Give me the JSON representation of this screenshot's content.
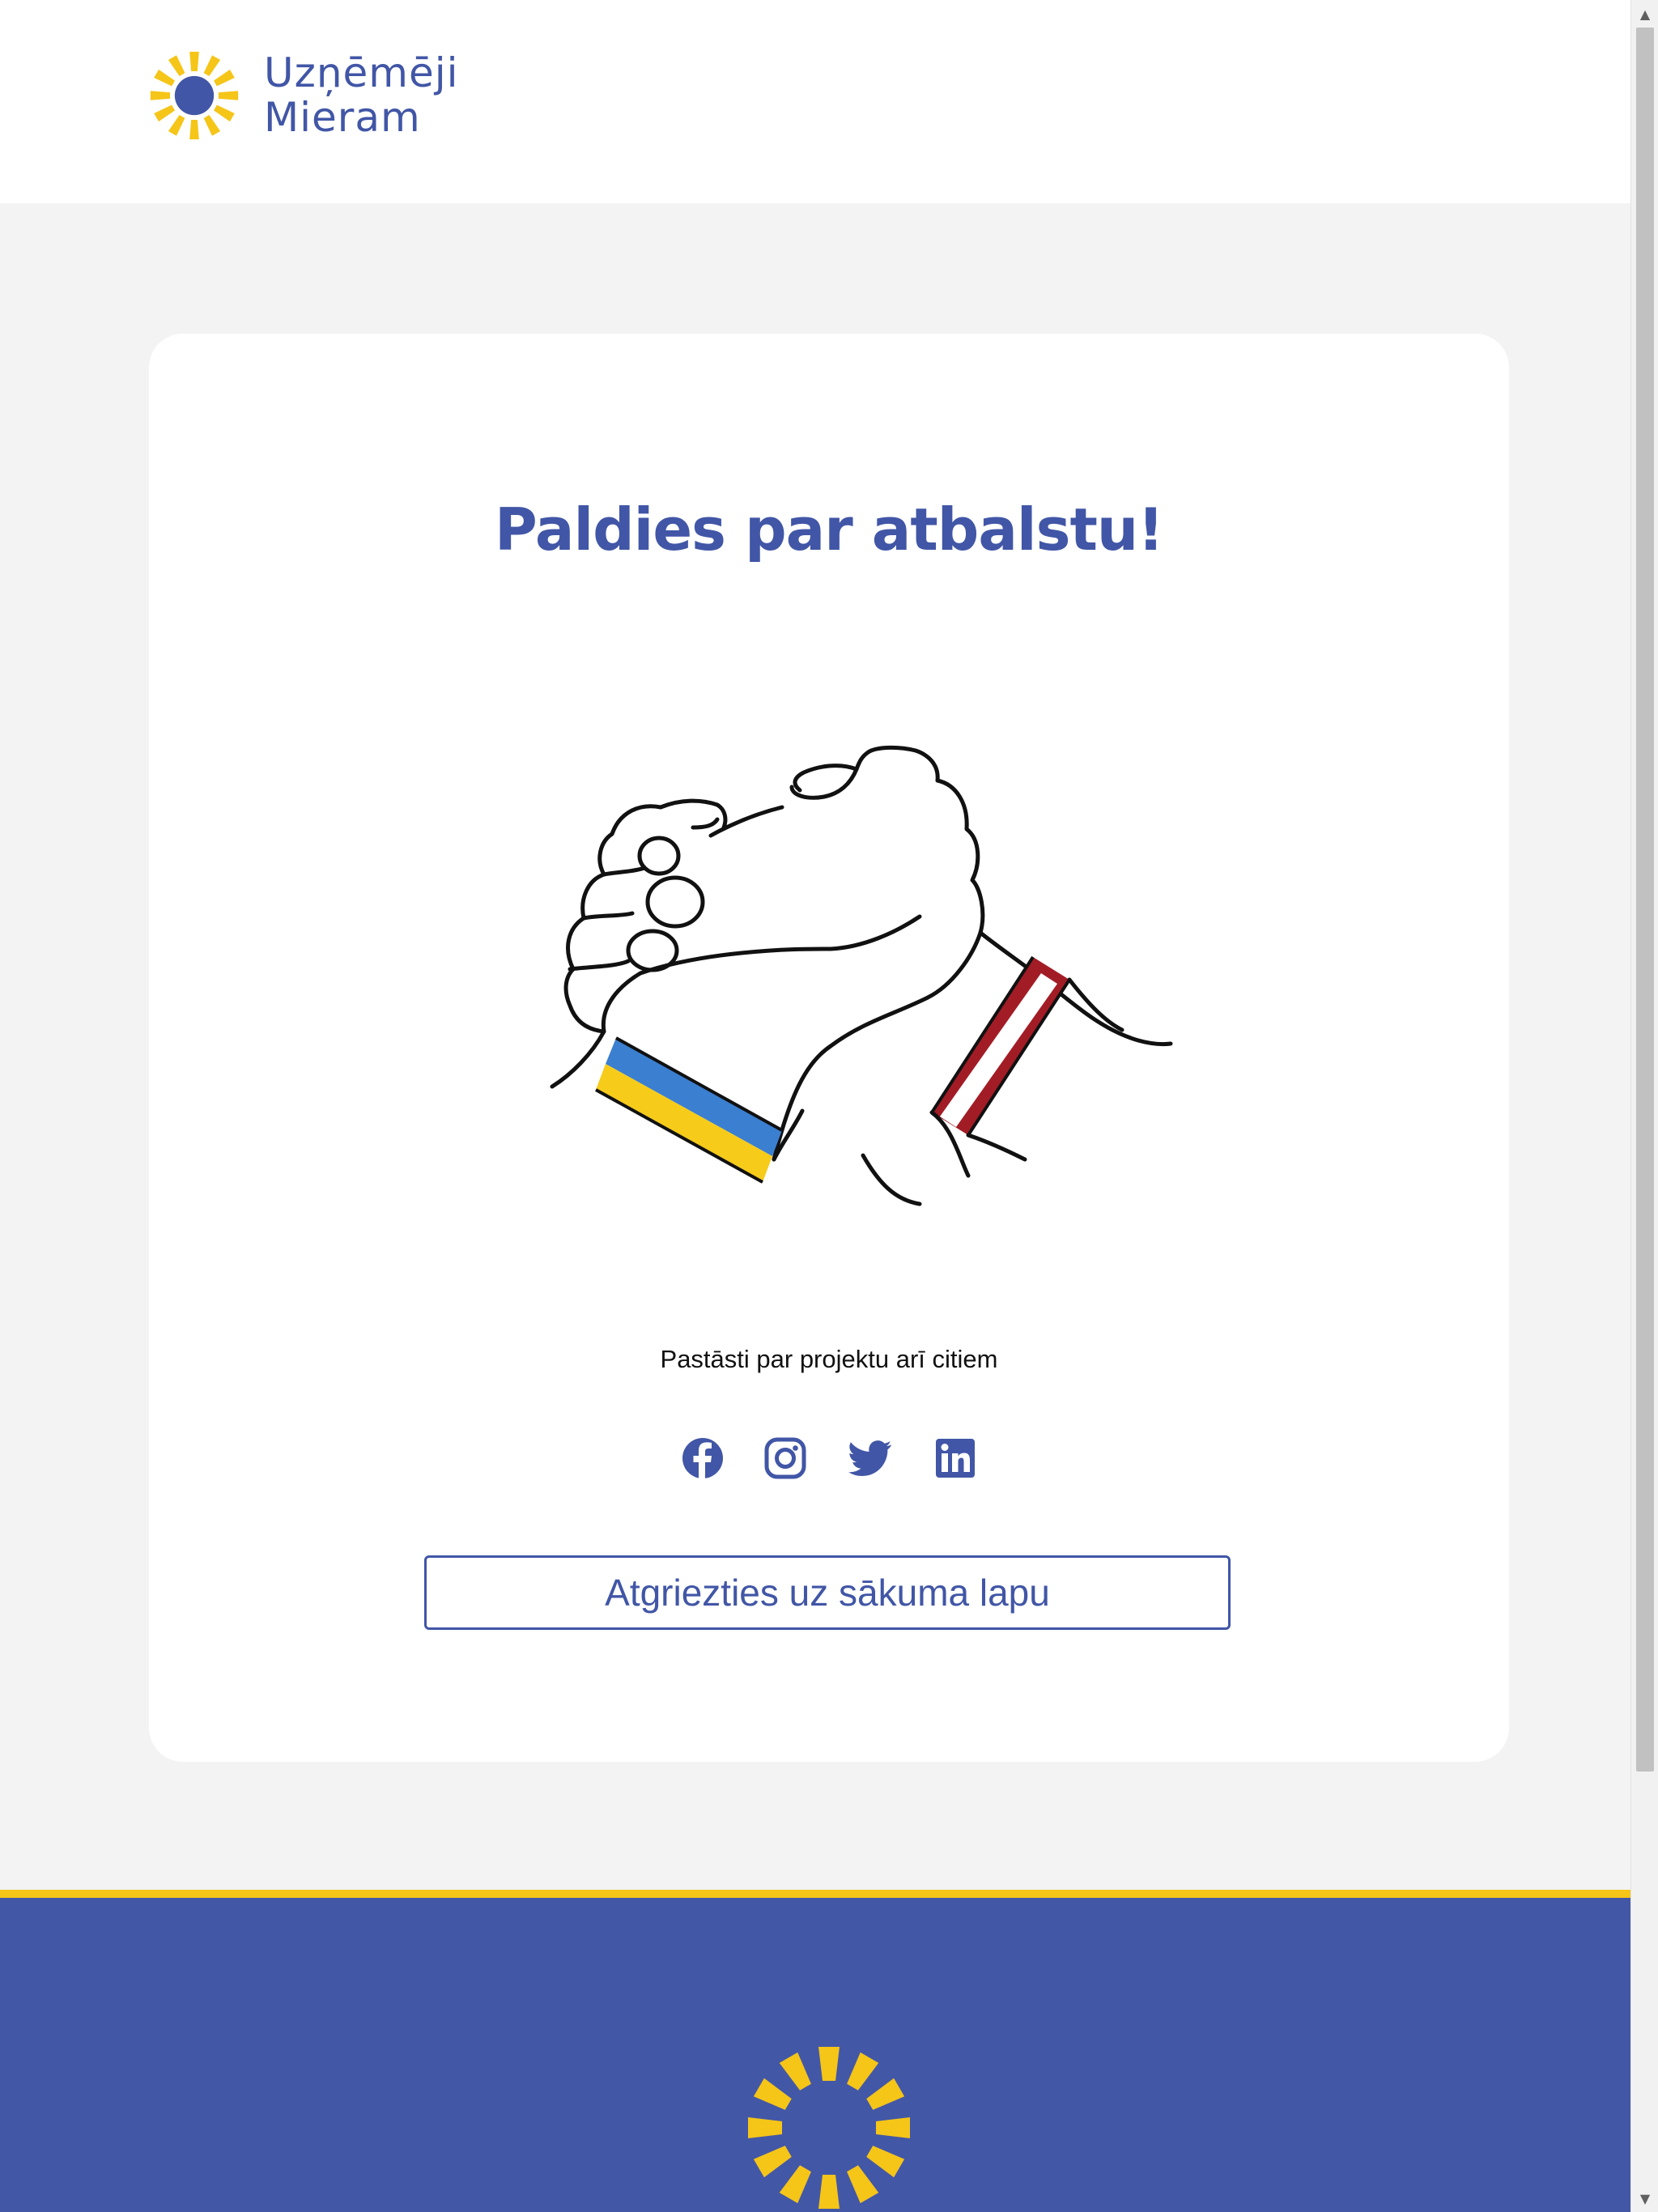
{
  "header": {
    "logo_line1": "Uzņēmēji",
    "logo_line2": "Mieram"
  },
  "card": {
    "title": "Paldies par atbalstu!",
    "share_text": "Pastāsti par projektu arī citiem",
    "back_button_label": "Atgriezties uz sākuma lapu"
  },
  "social": [
    "facebook-icon",
    "instagram-icon",
    "twitter-icon",
    "linkedin-icon"
  ],
  "colors": {
    "brand_blue": "#4156a6",
    "brand_yellow": "#f5c518",
    "page_background": "#f3f3f3",
    "ukraine_blue": "#3b7fd0",
    "ukraine_yellow": "#f6cb1a",
    "latvia_red": "#a21c26"
  }
}
